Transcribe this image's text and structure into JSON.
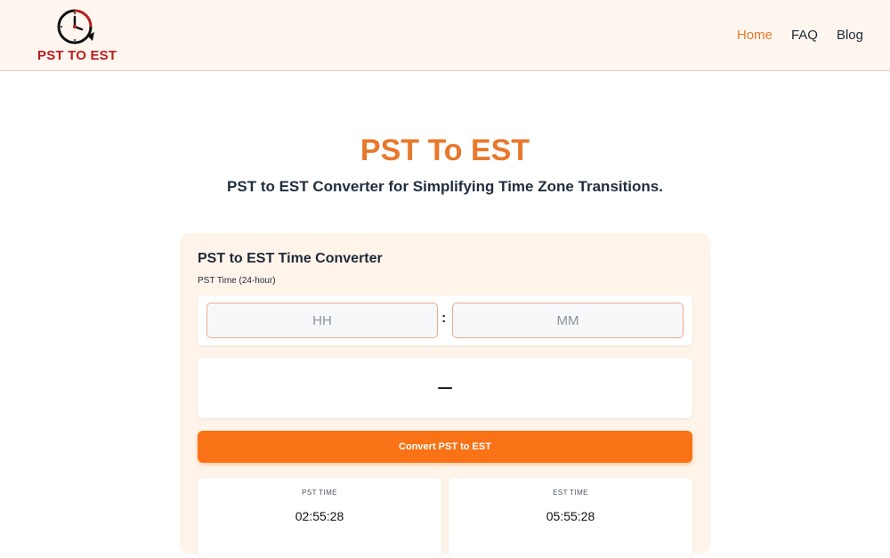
{
  "brand": {
    "logo_text": "PST TO EST",
    "colors": {
      "accent": "#e8782b",
      "button": "#f97316",
      "logo_red": "#b91c1c"
    }
  },
  "nav": {
    "items": [
      {
        "label": "Home",
        "active": true
      },
      {
        "label": "FAQ",
        "active": false
      },
      {
        "label": "Blog",
        "active": false
      }
    ]
  },
  "hero": {
    "title": "PST To EST",
    "subtitle": "PST to EST Converter for Simplifying Time Zone Transitions."
  },
  "converter": {
    "title": "PST to EST Time Converter",
    "input_label": "PST Time (24-hour)",
    "hour_placeholder": "HH",
    "minute_placeholder": "MM",
    "separator": ":",
    "result": "–",
    "button_label": "Convert PST to EST"
  },
  "clocks": {
    "pst": {
      "label": "PST TIME",
      "value": "02:55:28"
    },
    "est": {
      "label": "EST TIME",
      "value": "05:55:28"
    }
  },
  "icons": [
    "clock-icon"
  ]
}
